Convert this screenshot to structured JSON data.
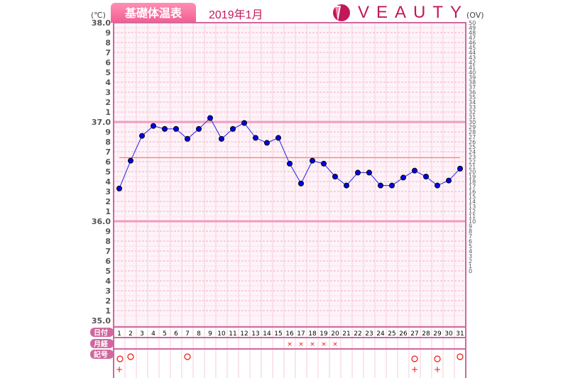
{
  "header": {
    "title": "基礎体温表",
    "month": "2019年1月",
    "brand": "VEAUTY",
    "unit_left": "(℃)",
    "unit_right": "(OV)"
  },
  "colors": {
    "accent": "#f35d92",
    "frame": "#d0679e",
    "line": "#2222ee",
    "point": "#0000ee",
    "coverline": "#ff6655",
    "mark": "#ee1111"
  },
  "rows": {
    "date": "日付",
    "menses": "月経",
    "symbol": "記号"
  },
  "chart_data": {
    "type": "line",
    "title": "",
    "xlabel": "日付",
    "ylabel": "(℃)",
    "ylim": [
      35.0,
      38.0
    ],
    "y2label": "(OV)",
    "y2lim": [
      0,
      50
    ],
    "grid": true,
    "x": [
      1,
      2,
      3,
      4,
      5,
      6,
      7,
      8,
      9,
      10,
      11,
      12,
      13,
      14,
      15,
      16,
      17,
      18,
      19,
      20,
      21,
      22,
      23,
      24,
      25,
      26,
      27,
      28,
      29,
      30,
      31
    ],
    "series": [
      {
        "values": [
          36.33,
          36.61,
          36.86,
          36.96,
          36.93,
          36.93,
          36.83,
          36.93,
          37.04,
          36.83,
          36.93,
          36.99,
          36.84,
          36.79,
          36.84,
          36.58,
          36.38,
          36.61,
          36.58,
          36.45,
          36.36,
          36.49,
          36.49,
          36.36,
          36.36,
          36.44,
          36.51,
          36.45,
          36.36,
          36.41,
          36.53
        ]
      }
    ],
    "coverline": 36.64,
    "menses_days": [
      16,
      17,
      18,
      19,
      20
    ],
    "menses_mark": "×",
    "circle_days": [
      1,
      2,
      7,
      27,
      29,
      31
    ],
    "plus_days": [
      1,
      27,
      29
    ],
    "circle_mark": "○",
    "plus_mark": "+"
  }
}
